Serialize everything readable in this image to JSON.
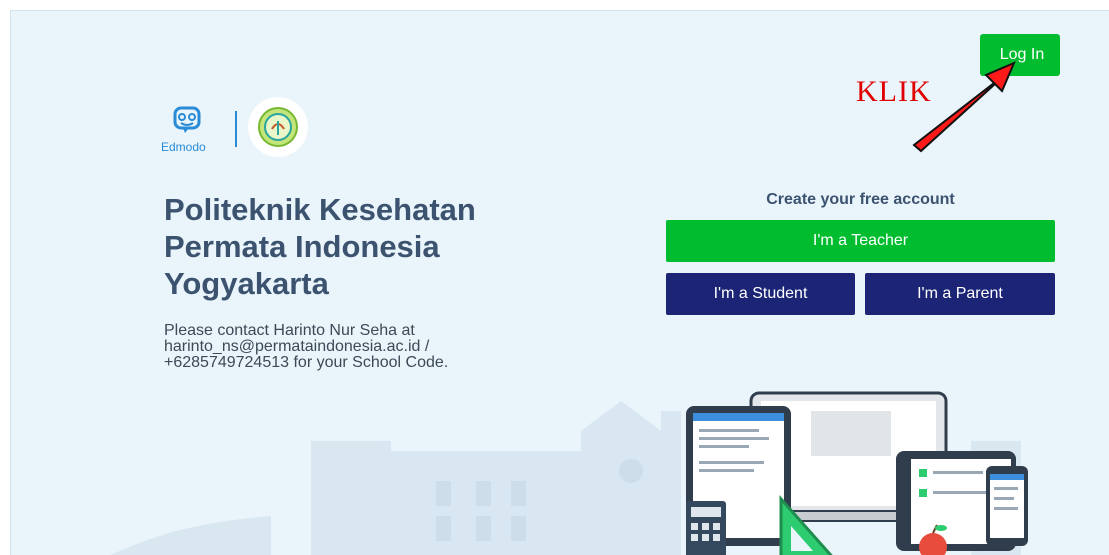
{
  "header": {
    "login_label": "Log In"
  },
  "annotation": {
    "klik_text": "KLIK",
    "arrow_color": "#e00000"
  },
  "brand": {
    "edmodo_text": "Edmodo",
    "accent": "#2a8cd6"
  },
  "school": {
    "name": "Politeknik Kesehatan Permata Indonesia Yogyakarta",
    "contact": "Please contact Harinto Nur Seha at harinto_ns@permataindonesia.ac.id / +6285749724513 for your School Code."
  },
  "signup": {
    "title": "Create your free account",
    "teacher_label": "I'm a Teacher",
    "student_label": "I'm a Student",
    "parent_label": "I'm a Parent"
  },
  "colors": {
    "green": "#00bd2f",
    "navy": "#1b2475",
    "background": "#e9f4fb",
    "title_text": "#3c5370"
  },
  "icons": [
    "edmodo-logo-icon",
    "school-logo-icon",
    "city-skyline-illustration",
    "devices-illustration"
  ]
}
